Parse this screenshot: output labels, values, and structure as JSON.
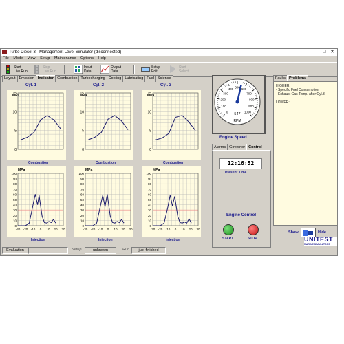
{
  "window": {
    "title": "Turbo Diesel 3 - Management Level Simulator (disconnected)"
  },
  "menu": [
    "File",
    "Mode",
    "View",
    "Setup",
    "Maintenance",
    "Options",
    "Help"
  ],
  "toolbar": {
    "start_live_run": "Start\nLive Run",
    "stop_live_run": "Stop\nLive Run",
    "input_data": "Input\nData",
    "output_data": "Output\nData",
    "setup_edit": "Setup\nEdit",
    "start_select": "Start\nSelect"
  },
  "tabs": [
    "Layout",
    "Emission",
    "Indicator",
    "Combustion",
    "Turbocharging",
    "Cooling",
    "Lubricating",
    "Fuel",
    "Science"
  ],
  "active_tab": "Indicator",
  "cylinders": [
    {
      "title": "Cyl. 1",
      "top_caption": "Combustion",
      "bottom_caption": "Injection"
    },
    {
      "title": "Cyl. 2",
      "top_caption": "Combustion",
      "bottom_caption": "Injection"
    },
    {
      "title": "Cyl. 3",
      "top_caption": "Combustion",
      "bottom_caption": "Injection"
    }
  ],
  "combustion_axis": {
    "unit": "MPa",
    "yticks": [
      "15",
      "10",
      "5",
      "0"
    ]
  },
  "injection_axis": {
    "unit": "MPa",
    "yticks": [
      "100",
      "90",
      "80",
      "70",
      "60",
      "50",
      "40",
      "30",
      "20",
      "10",
      "0"
    ],
    "xticks": [
      "-30",
      "-20",
      "-10",
      "0",
      "10",
      "20",
      "30"
    ]
  },
  "gauge": {
    "ticks": [
      "0",
      "100",
      "200",
      "300",
      "400",
      "500",
      "600",
      "700",
      "800",
      "900",
      "1000"
    ],
    "value": 547,
    "value_text": "547",
    "unit": "RPM",
    "label": "Engine Speed"
  },
  "sub_tabs": [
    "Alarms",
    "Governor",
    "Control"
  ],
  "time": {
    "value": "12:16:52",
    "label": "Present Time"
  },
  "engine_control": {
    "label": "Engine Control",
    "start": "START",
    "stop": "STOP"
  },
  "problems": {
    "tabs": [
      "Faults",
      "Problems"
    ],
    "lines": [
      "HIGHER:",
      "- Specific Fuel Consumption",
      "- Exhaust Gas Temp. after Cyl.3",
      "",
      "LOWER:"
    ],
    "show": "Show",
    "hide": "Hide"
  },
  "brand": {
    "name": "UNITEST",
    "sub": "MARINE SIMULATORS"
  },
  "status": {
    "evaluation": "Evaluation",
    "setup_label": "Setup",
    "setup_value": "unknown",
    "run_label": "Run",
    "run_value": "just finished"
  }
}
